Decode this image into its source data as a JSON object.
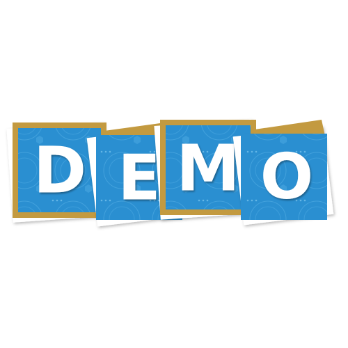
{
  "tiles": [
    {
      "letter": "D"
    },
    {
      "letter": "E"
    },
    {
      "letter": "M"
    },
    {
      "letter": "O"
    }
  ],
  "colors": {
    "tile_blue": "#2a8fd1",
    "tile_blue_dark": "#1d76b5",
    "frame_gold": "#c39a40",
    "frame_gold_light": "#d7b25d",
    "paper_white": "#ffffff",
    "letter_white": "#ffffff",
    "pattern_light": "#5fb6ea"
  }
}
